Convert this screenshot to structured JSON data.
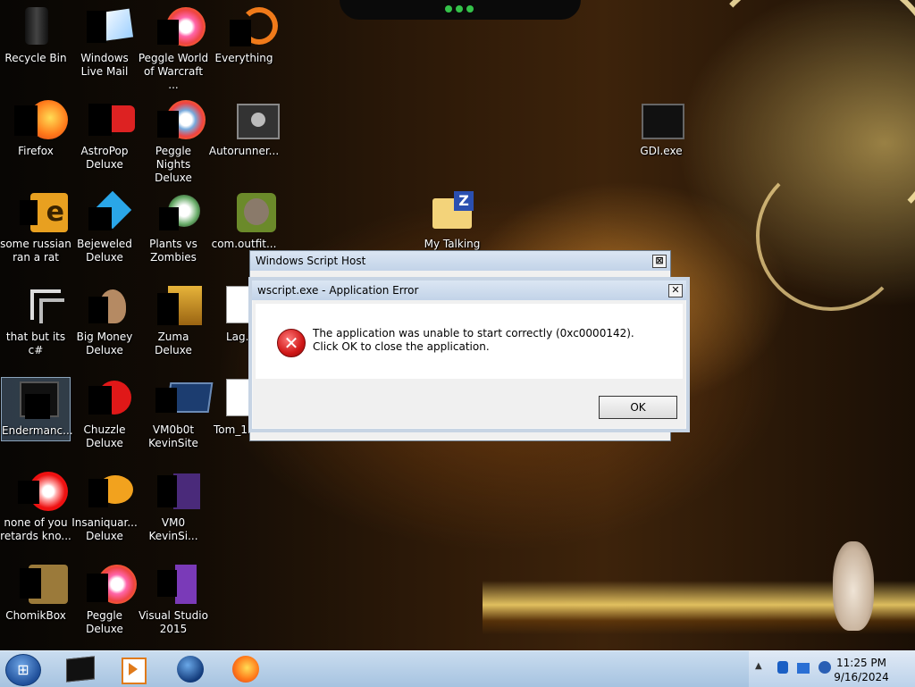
{
  "desktop": {
    "icons": [
      {
        "label": "Recycle Bin"
      },
      {
        "label": "Windows Live Mail"
      },
      {
        "label": "Peggle World of Warcraft ..."
      },
      {
        "label": "Everything"
      },
      {
        "label": "Firefox"
      },
      {
        "label": "AstroPop Deluxe"
      },
      {
        "label": "Peggle Nights Deluxe"
      },
      {
        "label": "Autorunner..."
      },
      {
        "label": "GDI.exe"
      },
      {
        "label": "some russian ran a rat"
      },
      {
        "label": "Bejeweled Deluxe"
      },
      {
        "label": "Plants vs Zombies"
      },
      {
        "label": "com.outfit..."
      },
      {
        "label": "My Talking"
      },
      {
        "label": "that but its c#"
      },
      {
        "label": "Big Money Deluxe"
      },
      {
        "label": "Zuma Deluxe"
      },
      {
        "label": "Lag..."
      },
      {
        "label": "Endermanc..."
      },
      {
        "label": "Chuzzle Deluxe"
      },
      {
        "label": "VM0b0t KevinSite"
      },
      {
        "label": "Tom_1..."
      },
      {
        "label": "none of you retards kno..."
      },
      {
        "label": "Insaniquar... Deluxe"
      },
      {
        "label": "VM0 KevinSi..."
      },
      {
        "label": "ChomikBox"
      },
      {
        "label": "Peggle Deluxe"
      },
      {
        "label": "Visual Studio 2015"
      }
    ]
  },
  "wsh_window": {
    "title": "Windows Script Host",
    "close": "⊠"
  },
  "error_dialog": {
    "title": "wscript.exe - Application Error",
    "close": "✕",
    "message": "The application was unable to start correctly (0xc0000142). Click OK to close the application.",
    "ok_label": "OK",
    "icon": "error-icon"
  },
  "taskbar": {
    "apps": [
      "terminal-icon",
      "media-player-icon",
      "browser-globe-icon",
      "firefox-icon"
    ],
    "tray_arrow": "▲",
    "time": "11:25 PM",
    "date": "9/16/2024"
  }
}
